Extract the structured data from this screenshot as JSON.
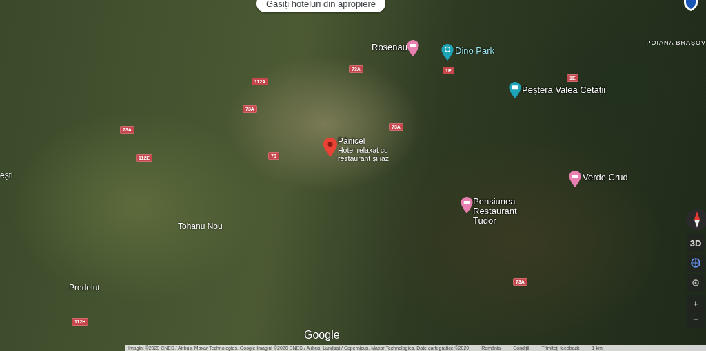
{
  "search_chip": {
    "label": "Găsiți hoteluri din apropiere"
  },
  "places": [
    {
      "kind": "selected",
      "name": "Pănicel",
      "subtitle": "Hotel relaxat cu restaurant și iaz"
    },
    {
      "kind": "hotel",
      "name": "Rosenau"
    },
    {
      "kind": "park",
      "name": "Dino Park"
    },
    {
      "kind": "sight",
      "name": "Peștera Valea Cetății"
    },
    {
      "kind": "hotel",
      "name": "Verde Crud"
    },
    {
      "kind": "hotel",
      "name": "Pensiunea Restaurant Tudor"
    }
  ],
  "towns": [
    "ești",
    "Tohanu Nou",
    "Predeluț",
    "POIANA BRAȘOV"
  ],
  "roads": [
    "112A",
    "73A",
    "73A",
    "73A",
    "112E",
    "73",
    "73A",
    "1E",
    "1E",
    "73A",
    "112H"
  ],
  "controls": {
    "mode": "3D",
    "zoom_in": "+",
    "zoom_out": "−"
  },
  "logo": "Google",
  "attribution": [
    "Imagini ©2020 CNES / Airbus, Maxar Technologies, Google Imagini ©2020 CNES / Airbus, Landsat / Copernicus, Maxar Technologies, Date cartografice ©2020",
    "România",
    "Condiții",
    "Trimiteți feedback",
    "1 km"
  ]
}
